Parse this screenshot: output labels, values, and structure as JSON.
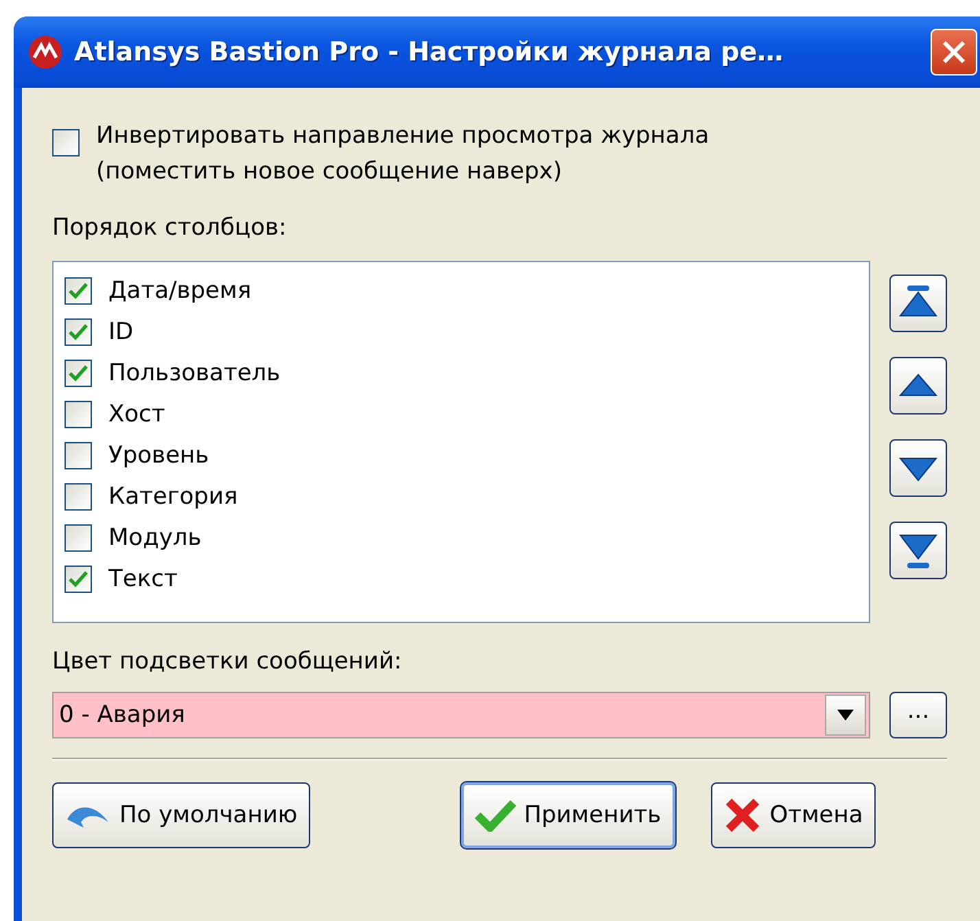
{
  "window": {
    "title": "Atlansys Bastion Pro - Настройки журнала ре…"
  },
  "invert": {
    "label": "Инвертировать направление просмотра журнала\n(поместить новое сообщение наверх)",
    "checked": false
  },
  "columns_label": "Порядок столбцов:",
  "columns": [
    {
      "label": "Дата/время",
      "checked": true
    },
    {
      "label": "ID",
      "checked": true
    },
    {
      "label": "Пользователь",
      "checked": true
    },
    {
      "label": "Хост",
      "checked": false
    },
    {
      "label": "Уровень",
      "checked": false
    },
    {
      "label": "Категория",
      "checked": false
    },
    {
      "label": "Модуль",
      "checked": false
    },
    {
      "label": "Текст",
      "checked": true
    }
  ],
  "highlight_label": "Цвет подсветки сообщений:",
  "highlight_select": {
    "value": "0 - Авария"
  },
  "browse_button": "...",
  "buttons": [
    {
      "kind": "default",
      "label": "По умолчанию",
      "focused": false
    },
    {
      "kind": "apply",
      "label": "Применить",
      "focused": true
    },
    {
      "kind": "cancel",
      "label": "Отмена",
      "focused": false
    }
  ]
}
